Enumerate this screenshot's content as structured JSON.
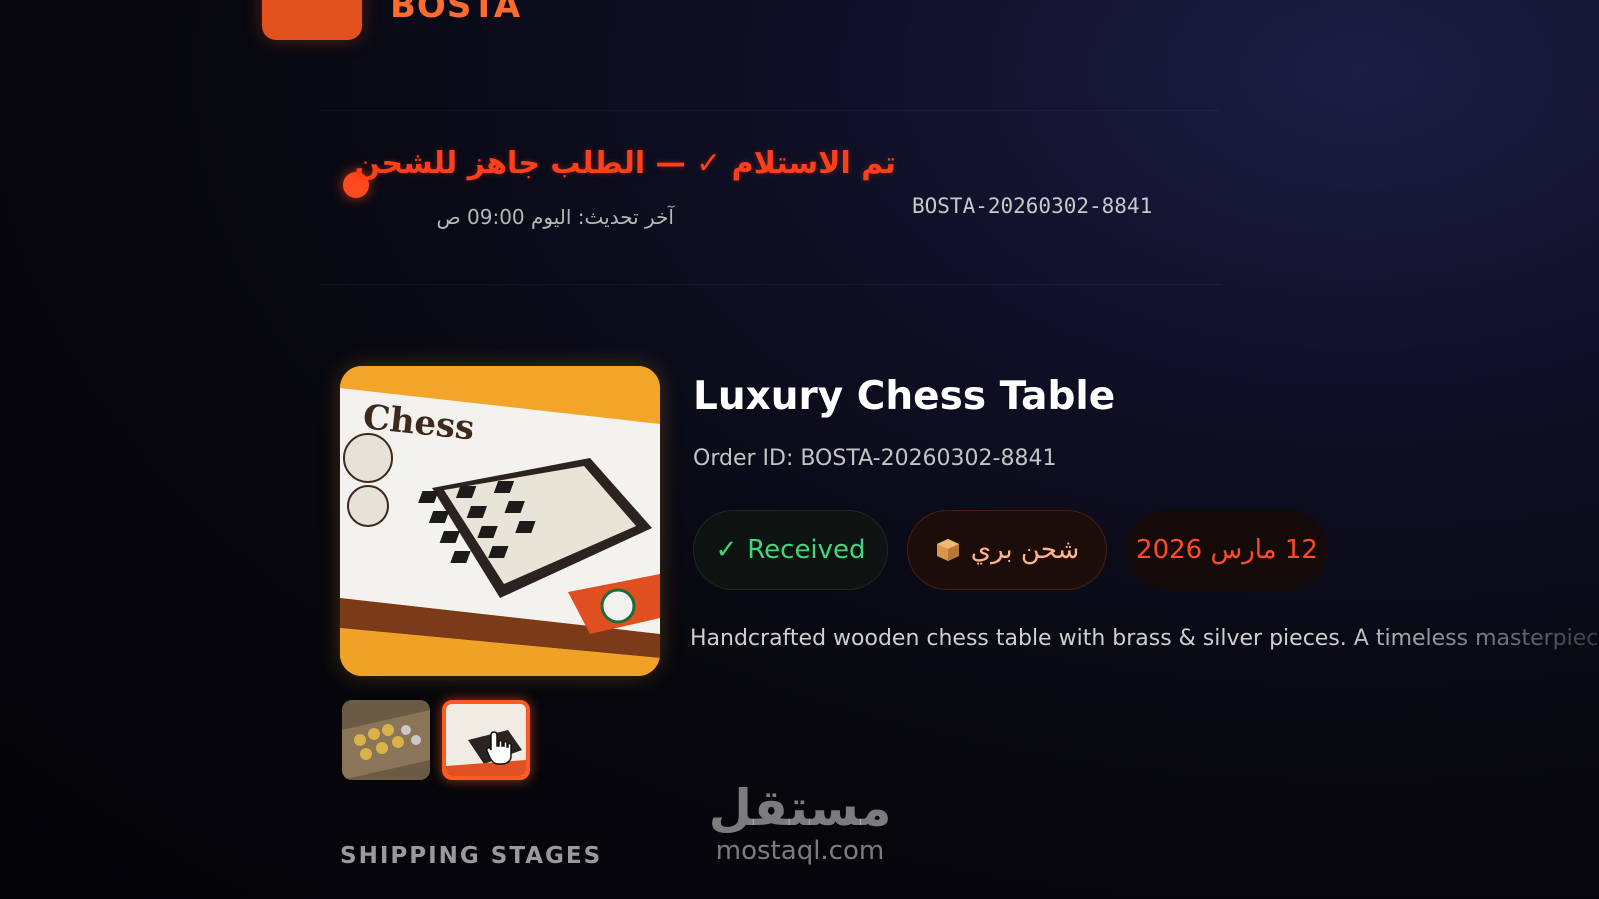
{
  "brand": {
    "name": "BOSTA",
    "color": "#e2521f"
  },
  "status": {
    "title": "تم الاستلام ✓ — الطلب جاهز للشحن",
    "last_update": "آخر تحديث: اليوم 09:00 ص",
    "order_number": "BOSTA-20260302-8841",
    "color": "#ff3e1a"
  },
  "product": {
    "title": "Luxury Chess Table",
    "order_id": "Order ID: BOSTA-20260302-8841",
    "image_box_text": "Chess",
    "description": "Handcrafted wooden chess table with brass & silver pieces. A timeless masterpiece",
    "badges": {
      "received": {
        "icon": "check-icon",
        "icon_glyph": "✓",
        "label": "Received",
        "color": "#3fd77a"
      },
      "shipping": {
        "icon": "package-icon",
        "label": "شحن بري",
        "color": "#ffb48c"
      },
      "date": {
        "label": "12 مارس 2026",
        "color": "#ff4a26"
      }
    },
    "thumbnails": [
      {
        "name": "chess-pieces-thumbnail",
        "selected": false
      },
      {
        "name": "chess-box-thumbnail",
        "selected": true
      }
    ]
  },
  "sections": {
    "shipping_stages": "SHIPPING STAGES"
  },
  "watermark": {
    "arabic": "مستقل",
    "latin": "mostaql.com"
  }
}
